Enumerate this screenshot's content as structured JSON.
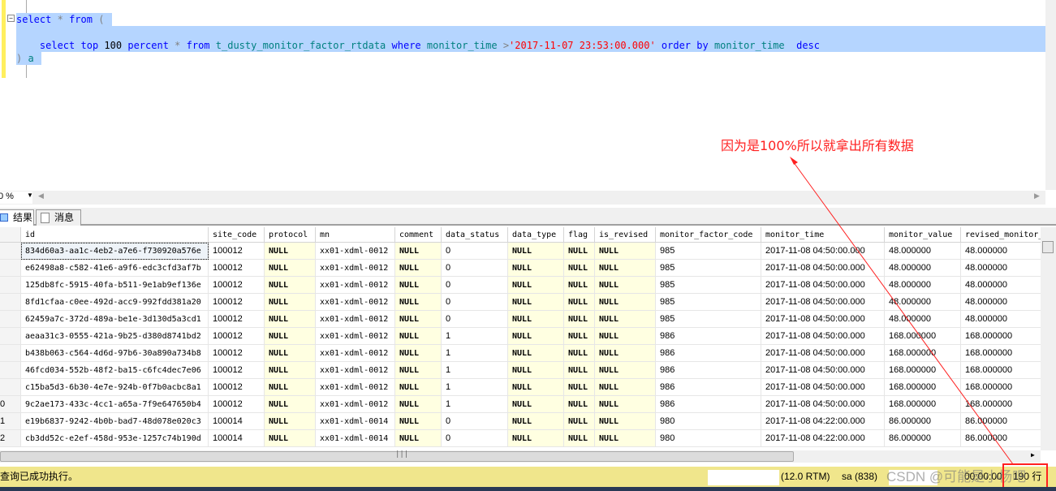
{
  "editor": {
    "line1": {
      "select": "select",
      "star": "*",
      "from": "from",
      "paren": "("
    },
    "line2": {
      "select": "select",
      "top": "top",
      "n": "100",
      "percent": "percent",
      "star": "*",
      "from": "from",
      "table": "t_dusty_monitor_factor_rtdata",
      "where": "where",
      "col": "monitor_time",
      "gt": ">",
      "value": "'2017-11-07 23:53:00.000'",
      "order": "order",
      "by": "by",
      "col2": "monitor_time",
      "desc": "desc"
    },
    "line3": {
      "paren": ")",
      "alias": "a"
    }
  },
  "annotation": {
    "text": "因为是100%所以就拿出所有数据",
    "color": "#ff2020"
  },
  "zoom": {
    "value": "0 %"
  },
  "tabs": [
    {
      "label": "结果",
      "icon": "grid-icon"
    },
    {
      "label": "消息",
      "icon": "message-icon"
    }
  ],
  "columns": [
    "id",
    "site_code",
    "protocol",
    "mn",
    "comment",
    "data_status",
    "data_type",
    "flag",
    "is_revised",
    "monitor_factor_code",
    "monitor_time",
    "monitor_value",
    "revised_monitor_"
  ],
  "rows": [
    {
      "rn": "",
      "id": "834d60a3-aa1c-4eb2-a7e6-f730920a576e",
      "site": "100012",
      "mn": "xx01-xdml-0012",
      "status": "0",
      "code": "985",
      "time": "2017-11-08 04:50:00.000",
      "value": "48.000000",
      "revised": "48.000000"
    },
    {
      "rn": "",
      "id": "e62498a8-c582-41e6-a9f6-edc3cfd3af7b",
      "site": "100012",
      "mn": "xx01-xdml-0012",
      "status": "0",
      "code": "985",
      "time": "2017-11-08 04:50:00.000",
      "value": "48.000000",
      "revised": "48.000000"
    },
    {
      "rn": "",
      "id": "125db8fc-5915-40fa-b511-9e1ab9ef136e",
      "site": "100012",
      "mn": "xx01-xdml-0012",
      "status": "0",
      "code": "985",
      "time": "2017-11-08 04:50:00.000",
      "value": "48.000000",
      "revised": "48.000000"
    },
    {
      "rn": "",
      "id": "8fd1cfaa-c0ee-492d-acc9-992fdd381a20",
      "site": "100012",
      "mn": "xx01-xdml-0012",
      "status": "0",
      "code": "985",
      "time": "2017-11-08 04:50:00.000",
      "value": "48.000000",
      "revised": "48.000000"
    },
    {
      "rn": "",
      "id": "62459a7c-372d-489a-be1e-3d130d5a3cd1",
      "site": "100012",
      "mn": "xx01-xdml-0012",
      "status": "0",
      "code": "985",
      "time": "2017-11-08 04:50:00.000",
      "value": "48.000000",
      "revised": "48.000000"
    },
    {
      "rn": "",
      "id": "aeaa31c3-0555-421a-9b25-d380d8741bd2",
      "site": "100012",
      "mn": "xx01-xdml-0012",
      "status": "1",
      "code": "986",
      "time": "2017-11-08 04:50:00.000",
      "value": "168.000000",
      "revised": "168.000000"
    },
    {
      "rn": "",
      "id": "b438b063-c564-4d6d-97b6-30a890a734b8",
      "site": "100012",
      "mn": "xx01-xdml-0012",
      "status": "1",
      "code": "986",
      "time": "2017-11-08 04:50:00.000",
      "value": "168.000000",
      "revised": "168.000000"
    },
    {
      "rn": "",
      "id": "46fcd034-552b-48f2-ba15-c6fc4dec7e06",
      "site": "100012",
      "mn": "xx01-xdml-0012",
      "status": "1",
      "code": "986",
      "time": "2017-11-08 04:50:00.000",
      "value": "168.000000",
      "revised": "168.000000"
    },
    {
      "rn": "",
      "id": "c15ba5d3-6b30-4e7e-924b-0f7b0acbc8a1",
      "site": "100012",
      "mn": "xx01-xdml-0012",
      "status": "1",
      "code": "986",
      "time": "2017-11-08 04:50:00.000",
      "value": "168.000000",
      "revised": "168.000000"
    },
    {
      "rn": "0",
      "id": "9c2ae173-433c-4cc1-a65a-7f9e647650b4",
      "site": "100012",
      "mn": "xx01-xdml-0012",
      "status": "1",
      "code": "986",
      "time": "2017-11-08 04:50:00.000",
      "value": "168.000000",
      "revised": "168.000000"
    },
    {
      "rn": "1",
      "id": "e19b6837-9242-4b0b-bad7-48d078e020c3",
      "site": "100014",
      "mn": "xx01-xdml-0014",
      "status": "0",
      "code": "980",
      "time": "2017-11-08 04:22:00.000",
      "value": "86.000000",
      "revised": "86.000000"
    },
    {
      "rn": "2",
      "id": "cb3dd52c-e2ef-458d-953e-1257c74b190d",
      "site": "100014",
      "mn": "xx01-xdml-0014",
      "status": "0",
      "code": "980",
      "time": "2017-11-08 04:22:00.000",
      "value": "86.000000",
      "revised": "86.000000"
    }
  ],
  "null_text": "NULL",
  "status": {
    "message": "查询已成功执行。",
    "version": "(12.0 RTM)",
    "user": "sa (838)",
    "elapsed": "00:00:00",
    "rows": "190 行",
    "bg": "#f0e68c"
  },
  "watermark": "CSDN @可能是小杨吧"
}
